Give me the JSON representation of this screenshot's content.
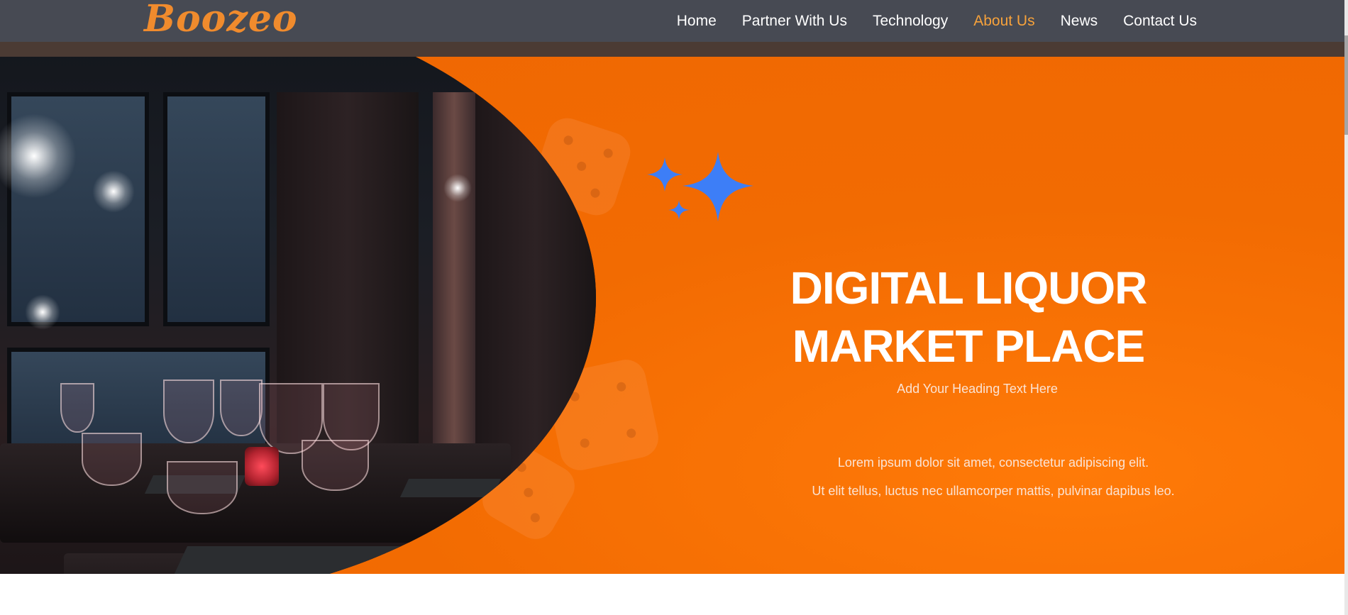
{
  "brand": {
    "logo_text": "Boozeo",
    "accent": "#f08b2d"
  },
  "nav": {
    "items": [
      {
        "label": "Home",
        "active": false
      },
      {
        "label": "Partner With Us",
        "active": false
      },
      {
        "label": "Technology",
        "active": false
      },
      {
        "label": "About Us",
        "active": true
      },
      {
        "label": "News",
        "active": false
      },
      {
        "label": "Contact Us",
        "active": false
      }
    ],
    "active_color": "#f7a23b"
  },
  "hero": {
    "title_line1": "DIGITAL LIQUOR",
    "title_line2": "MARKET PLACE",
    "subtitle": "Add Your Heading Text Here",
    "body_line1": "Lorem ipsum dolor sit amet, consectetur adipiscing elit.",
    "body_line2": "Ut elit tellus, luctus nec ullamcorper mattis, pulvinar dapibus leo.",
    "background_color": "#ef6703",
    "sparkle_color": "#3d7ef7",
    "image_alt": "restaurant-table-with-wine-glasses"
  }
}
